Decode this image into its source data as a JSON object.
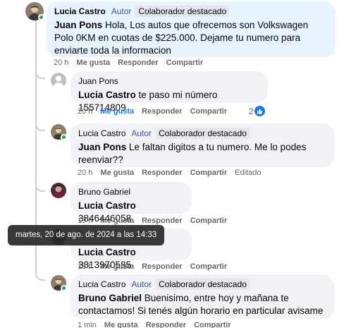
{
  "comments": [
    {
      "author": "Lucia Castro",
      "role": "Autor",
      "badge": "Colaborador destacado",
      "mention": "Juan Pons",
      "text": " Hola, Los autos que ofrecemos son Volkswagen Polo 0KM en cuotas de $225.000. Dejame tu numero para enviarte toda la informacion",
      "time": "20 h",
      "actions": {
        "like": "Me gusta",
        "reply": "Responder",
        "share": "Compartir"
      }
    },
    {
      "author": "Juan Pons",
      "mention": "Lucia Castro",
      "text": " te paso mi número 155714809",
      "time": "20 h",
      "actions": {
        "like": "Me gusta",
        "reply": "Responder",
        "share": "Compartir"
      },
      "reaction_count": "2"
    },
    {
      "author": "Lucia Castro",
      "role": "Autor",
      "badge": "Colaborador destacado",
      "mention": "Juan Pons",
      "text": " Le faltan digitos a tu numero. Me lo podes reenviar??",
      "time": "20 h",
      "actions": {
        "like": "Me gusta",
        "reply": "Responder",
        "share": "Compartir"
      },
      "edited": "Editado"
    },
    {
      "author": "Bruno Gabriel",
      "mention": "Lucia Castro",
      "text": " 3846446058",
      "time": "19 h",
      "actions": {
        "like": "Me gusta",
        "reply": "Responder",
        "share": "Compartir"
      }
    },
    {
      "mention": "Lucia Castro",
      "text": " 3813970585",
      "time": "18 h",
      "actions": {
        "like": "Me gusta",
        "reply": "Responder",
        "share": "Compartir"
      }
    },
    {
      "author": "Lucia Castro",
      "role": "Autor",
      "badge": "Colaborador destacado",
      "mention": "Bruno Gabriel",
      "text": " Buenisimo, entre hoy y mañana te contactamos! Si tenés algún horario en particular avisame",
      "time": "1 min",
      "actions": {
        "like": "Me gusta",
        "reply": "Responder",
        "share": "Compartir"
      }
    }
  ],
  "tooltip": "martes, 20 de ago. de 2024 a las 14:33",
  "colors": {
    "link_blue": "#1877f2",
    "role_blue": "#385898",
    "bubble": "#f0f2f5",
    "bubble_highlight": "#e7f3ff",
    "online": "#31a24c"
  },
  "icons": {
    "reaction": "like-icon",
    "presence": "online-dot"
  }
}
